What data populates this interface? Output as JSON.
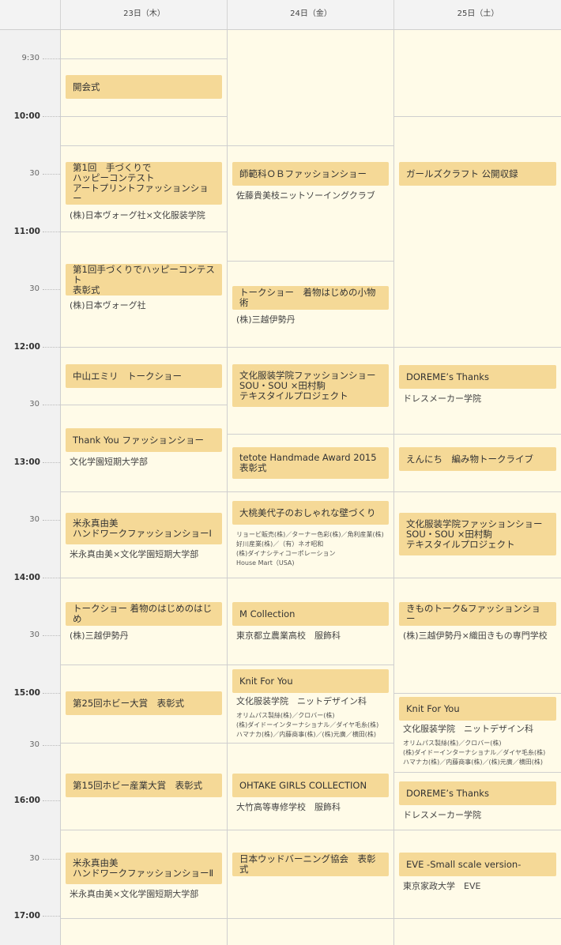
{
  "days": [
    "23日（木）",
    "24日（金）",
    "25日（土）"
  ],
  "times": [
    "9:30",
    "10:00",
    "30",
    "11:00",
    "30",
    "12:00",
    "30",
    "13:00",
    "30",
    "14:00",
    "30",
    "15:00",
    "30",
    "16:00",
    "30",
    "17:00"
  ],
  "thu": [
    {
      "title": "開会式"
    },
    {
      "title": "第1回　手づくりで\nハッピーコンテスト\nアートプリントファッションショー",
      "sub": "(株)日本ヴォーグ社×文化服装学院"
    },
    {
      "title": "第1回手づくりでハッピーコンテスト\n表彰式",
      "sub": "(株)日本ヴォーグ社"
    },
    {
      "title": "中山エミリ　トークショー"
    },
    {
      "title": "Thank You ファッションショー",
      "sub": "文化学園短期大学部"
    },
    {
      "title": "米永真由美\nハンドワークファッションショーⅠ",
      "sub": "米永真由美×文化学園短期大学部"
    },
    {
      "title": "トークショー 着物のはじめのはじめ",
      "sub": "(株)三越伊勢丹"
    },
    {
      "title": "第25回ホビー大賞　表彰式"
    },
    {
      "title": "第15回ホビー産業大賞　表彰式"
    },
    {
      "title": "米永真由美\nハンドワークファッションショーⅡ",
      "sub": "米永真由美×文化学園短期大学部"
    }
  ],
  "fri": [
    {
      "title": "師範科ＯＢファッションショー",
      "sub": "佐藤貴美枝ニットソーイングクラブ"
    },
    {
      "title": "トークショー　着物はじめの小物術",
      "sub": "(株)三越伊勢丹"
    },
    {
      "title": "文化服装学院ファッションショー\nSOU・SOU ×田村駒\nテキスタイルプロジェクト"
    },
    {
      "title": "tetote Handmade Award 2015\n表彰式"
    },
    {
      "title": "大桃美代子のおしゃれな壁づくり",
      "small": "リョービ販売(株)／ターナー色彩(株)／角利産業(株)\n好川産業(株)／（有）ネオ昭和\n(株)ダイナシティコーポレーション\nHouse Mart（USA)"
    },
    {
      "title": "M Collection",
      "sub": "東京都立農業高校　服飾科"
    },
    {
      "title": "Knit  For  You",
      "sub": "文化服装学院　ニットデザイン科",
      "small": "オリムパス製絲(株)／クロバー(株)\n(株)ダイドーインターナショナル／ダイヤ毛糸(株)\nハマナカ(株)／内藤商事(株)／(株)元廣／横田(株)"
    },
    {
      "title": "OHTAKE GIRLS COLLECTION",
      "sub": "大竹高等専修学校　服飾科"
    },
    {
      "title": "日本ウッドバーニング協会　表彰式"
    }
  ],
  "sat": [
    {
      "title": "ガールズクラフト 公開収録"
    },
    {
      "title": "DOREME’s Thanks",
      "sub": "ドレスメーカー学院"
    },
    {
      "title": "えんにち　編み物トークライブ"
    },
    {
      "title": "文化服装学院ファッションショー\nSOU・SOU ×田村駒\nテキスタイルプロジェクト"
    },
    {
      "title": "きものトーク&ファッションショー",
      "sub": "(株)三越伊勢丹×織田きもの専門学校"
    },
    {
      "title": "Knit  For  You",
      "sub": "文化服装学院　ニットデザイン科",
      "small": "オリムパス製絲(株)／クロバー(株)\n(株)ダイドーインターナショナル／ダイヤ毛糸(株)\nハマナカ(株)／内藤商事(株)／(株)元廣／横田(株)"
    },
    {
      "title": "DOREME’s Thanks",
      "sub": "ドレスメーカー学院"
    },
    {
      "title": "EVE -Small scale version-",
      "sub": "東京家政大学　EVE"
    }
  ]
}
